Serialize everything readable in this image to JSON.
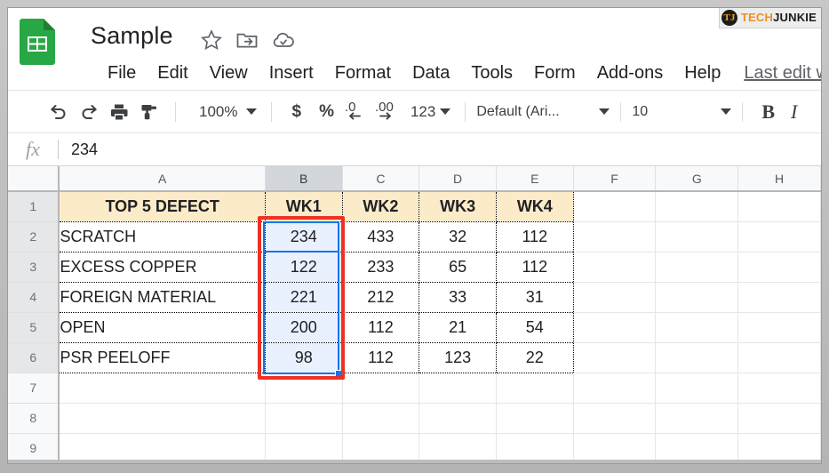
{
  "app": {
    "name": "Google Sheets",
    "doc_title": "Sample",
    "logo_icon": "sheets-icon",
    "title_icons": [
      "star-icon",
      "move-to-folder-icon",
      "cloud-saved-icon"
    ],
    "last_edit": "Last edit wa"
  },
  "watermark": {
    "badge": "TJ",
    "tech": "TECH",
    "junkie": "JUNKIE",
    "tech_color": "#ef8f1c",
    "junkie_color": "#1b1b1b"
  },
  "menubar": {
    "items": [
      {
        "label": "File"
      },
      {
        "label": "Edit"
      },
      {
        "label": "View"
      },
      {
        "label": "Insert"
      },
      {
        "label": "Format"
      },
      {
        "label": "Data"
      },
      {
        "label": "Tools"
      },
      {
        "label": "Form"
      },
      {
        "label": "Add-ons"
      },
      {
        "label": "Help"
      }
    ]
  },
  "toolbar": {
    "undo_icon": "undo-icon",
    "redo_icon": "redo-icon",
    "print_icon": "print-icon",
    "paint_format_icon": "paint-format-icon",
    "zoom_value": "100%",
    "currency_label": "$",
    "percent_label": "%",
    "decrease_decimal_label": ".0",
    "increase_decimal_label": ".00",
    "number_format_label": "123",
    "font_name": "Default (Ari...",
    "font_size": "10",
    "bold_label": "B",
    "italic_label": "I"
  },
  "formula_bar": {
    "fx_label": "fx",
    "value": "234",
    "placeholder": ""
  },
  "sheet": {
    "columns": [
      "A",
      "B",
      "C",
      "D",
      "E",
      "F",
      "G",
      "H"
    ],
    "selected_column": "B",
    "rows": [
      "1",
      "2",
      "3",
      "4",
      "5",
      "6",
      "7",
      "8",
      "9"
    ],
    "selected_rows": [
      "1",
      "2",
      "3",
      "4",
      "5",
      "6"
    ],
    "selection_range": "B2:B6",
    "active_cell": "B2",
    "header_fill": "#fcebc8",
    "selection_fill": "#eaf1fe",
    "selection_border": "#1a73e8",
    "annotation_color": "#ef3124",
    "table": {
      "header": [
        "TOP 5 DEFECT",
        "WK1",
        "WK2",
        "WK3",
        "WK4"
      ],
      "data": [
        {
          "defect": "SCRATCH",
          "wk1": "234",
          "wk2": "433",
          "wk3": "32",
          "wk4": "112"
        },
        {
          "defect": "EXCESS COPPER",
          "wk1": "122",
          "wk2": "233",
          "wk3": "65",
          "wk4": "112"
        },
        {
          "defect": "FOREIGN MATERIAL",
          "wk1": "221",
          "wk2": "212",
          "wk3": "33",
          "wk4": "31"
        },
        {
          "defect": "OPEN",
          "wk1": "200",
          "wk2": "112",
          "wk3": "21",
          "wk4": "54"
        },
        {
          "defect": "PSR PEELOFF",
          "wk1": "98",
          "wk2": "112",
          "wk3": "123",
          "wk4": "22"
        }
      ]
    }
  },
  "chart_data": {
    "type": "table",
    "title": "TOP 5 DEFECT",
    "categories": [
      "SCRATCH",
      "EXCESS COPPER",
      "FOREIGN MATERIAL",
      "OPEN",
      "PSR PEELOFF"
    ],
    "series": [
      {
        "name": "WK1",
        "values": [
          234,
          122,
          221,
          200,
          98
        ]
      },
      {
        "name": "WK2",
        "values": [
          433,
          233,
          212,
          112,
          112
        ]
      },
      {
        "name": "WK3",
        "values": [
          32,
          65,
          33,
          21,
          123
        ]
      },
      {
        "name": "WK4",
        "values": [
          112,
          112,
          31,
          54,
          22
        ]
      }
    ],
    "xlabel": "TOP 5 DEFECT",
    "ylabel": "",
    "grid": true
  }
}
